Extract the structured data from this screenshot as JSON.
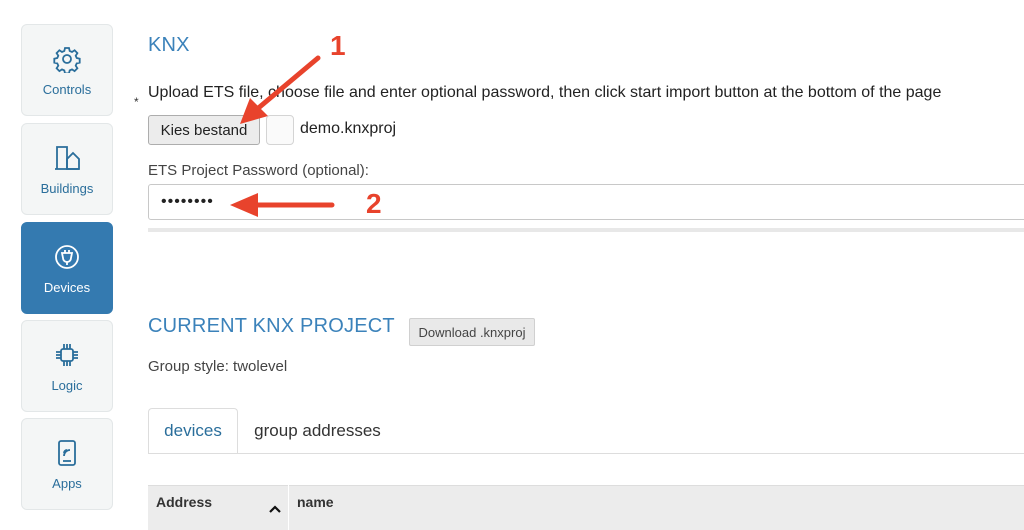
{
  "sidebar": {
    "items": [
      {
        "label": "Controls",
        "icon": "gear-icon",
        "active": false
      },
      {
        "label": "Buildings",
        "icon": "building-icon",
        "active": false
      },
      {
        "label": "Devices",
        "icon": "plug-icon",
        "active": true
      },
      {
        "label": "Logic",
        "icon": "chip-icon",
        "active": false
      },
      {
        "label": "Apps",
        "icon": "tablet-icon",
        "active": false
      }
    ]
  },
  "knx": {
    "title": "KNX",
    "required_marker": "*",
    "upload_instruction": "Upload ETS file, choose file and enter optional password, then click start import button at the bottom of the page",
    "file_button_label": "Kies bestand",
    "file_name": "demo.knxproj",
    "password_label": "ETS Project Password (optional):",
    "password_value": "••••••••"
  },
  "current_project": {
    "title": "CURRENT KNX PROJECT",
    "download_label": "Download .knxproj",
    "group_style": "Group style: twolevel",
    "tabs": [
      {
        "label": "devices",
        "active": true
      },
      {
        "label": "group addresses",
        "active": false
      }
    ],
    "table": {
      "columns": [
        "Address",
        "name"
      ]
    }
  },
  "annotations": {
    "one": "1",
    "two": "2",
    "color": "#e8432c"
  },
  "colors": {
    "accent": "#347ab0",
    "title": "#3b82ba"
  }
}
